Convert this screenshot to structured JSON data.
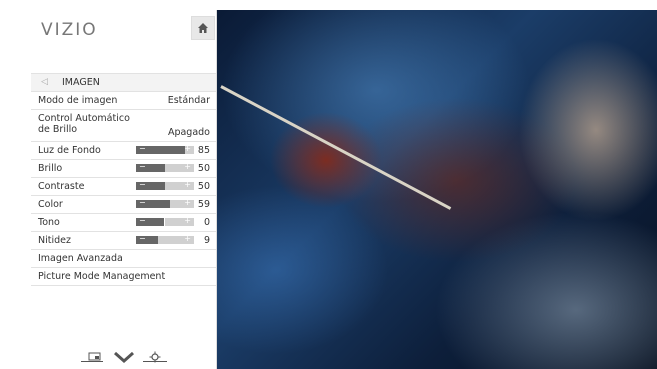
{
  "brand": "VIZIO",
  "colors": {
    "panel_bg": "#ffffff",
    "slider_track": "#d0d0d0",
    "slider_fill": "#666666"
  },
  "menu": {
    "title": "IMAGEN",
    "items": [
      {
        "label": "Modo de imagen",
        "value": "Estándar"
      },
      {
        "label_line1": "Control Automático",
        "label_line2": "de Brillo",
        "value": "Apagado"
      },
      {
        "label": "Luz de Fondo",
        "value": "85",
        "level": 85
      },
      {
        "label": "Brillo",
        "value": "50",
        "level": 50
      },
      {
        "label": "Contraste",
        "value": "50",
        "level": 50
      },
      {
        "label": "Color",
        "value": "59",
        "level": 59
      },
      {
        "label": "Tono",
        "value": "0",
        "level": 0
      },
      {
        "label": "Nitidez",
        "value": "9",
        "level": 9
      },
      {
        "label": "Imagen Avanzada"
      },
      {
        "label": "Picture Mode Management"
      }
    ]
  },
  "icons": {
    "home": "home-icon",
    "back": "back-arrow-icon",
    "input": "input-icon",
    "down": "chevron-down-icon",
    "settings": "settings-icon"
  }
}
